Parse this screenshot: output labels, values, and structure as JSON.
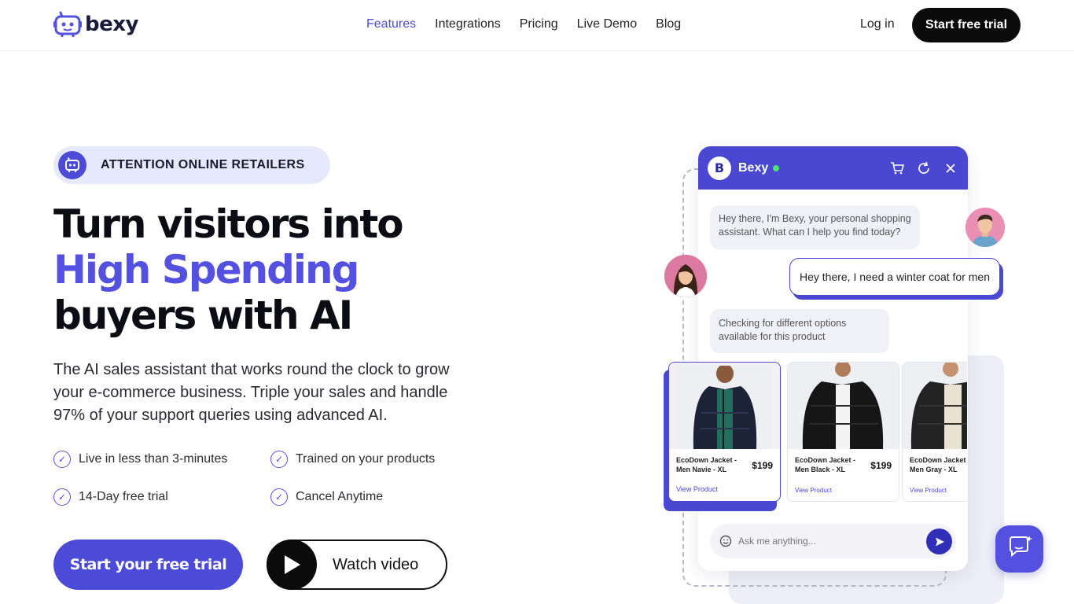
{
  "brand": {
    "name": "bexy",
    "accent": "#5451e0",
    "dark": "#0b0b0b"
  },
  "nav": {
    "items": [
      {
        "label": "Features",
        "active": true
      },
      {
        "label": "Integrations",
        "active": false
      },
      {
        "label": "Pricing",
        "active": false
      },
      {
        "label": "Live Demo",
        "active": false
      },
      {
        "label": "Blog",
        "active": false
      }
    ],
    "login": "Log in",
    "trial": "Start free trial"
  },
  "hero": {
    "badge": "ATTENTION ONLINE RETAILERS",
    "headline_line1": "Turn visitors into",
    "headline_accent": "High Spending",
    "headline_line3": "buyers with AI",
    "lead": "The AI sales assistant that works round the clock to grow your e-commerce business. Triple your sales and handle 97% of your support queries using advanced AI.",
    "features": [
      "Live in less than 3-minutes",
      "Trained on your products",
      "14-Day free trial",
      "Cancel Anytime"
    ],
    "cta_primary": "Start your free trial",
    "cta_video": "Watch video"
  },
  "chat": {
    "logo_letter": "B",
    "name": "Bexy",
    "icons": [
      "cart-icon",
      "refresh-icon",
      "close-icon"
    ],
    "bot_message_1": "Hey there, I'm Bexy, your personal shopping assistant. What can I help you find today?",
    "user_message": "Hey there, I need a winter coat for men",
    "bot_message_2": "Checking for different options available for this product",
    "products": [
      {
        "name": "EcoDown Jacket - Men Navie - XL",
        "price": "$199",
        "link": "View Product"
      },
      {
        "name": "EcoDown Jacket - Men Black - XL",
        "price": "$199",
        "link": "View Product"
      },
      {
        "name": "EcoDown Jacket - Men Gray - XL",
        "price": "",
        "link": "View Product"
      }
    ],
    "input_placeholder": "Ask me anything..."
  }
}
